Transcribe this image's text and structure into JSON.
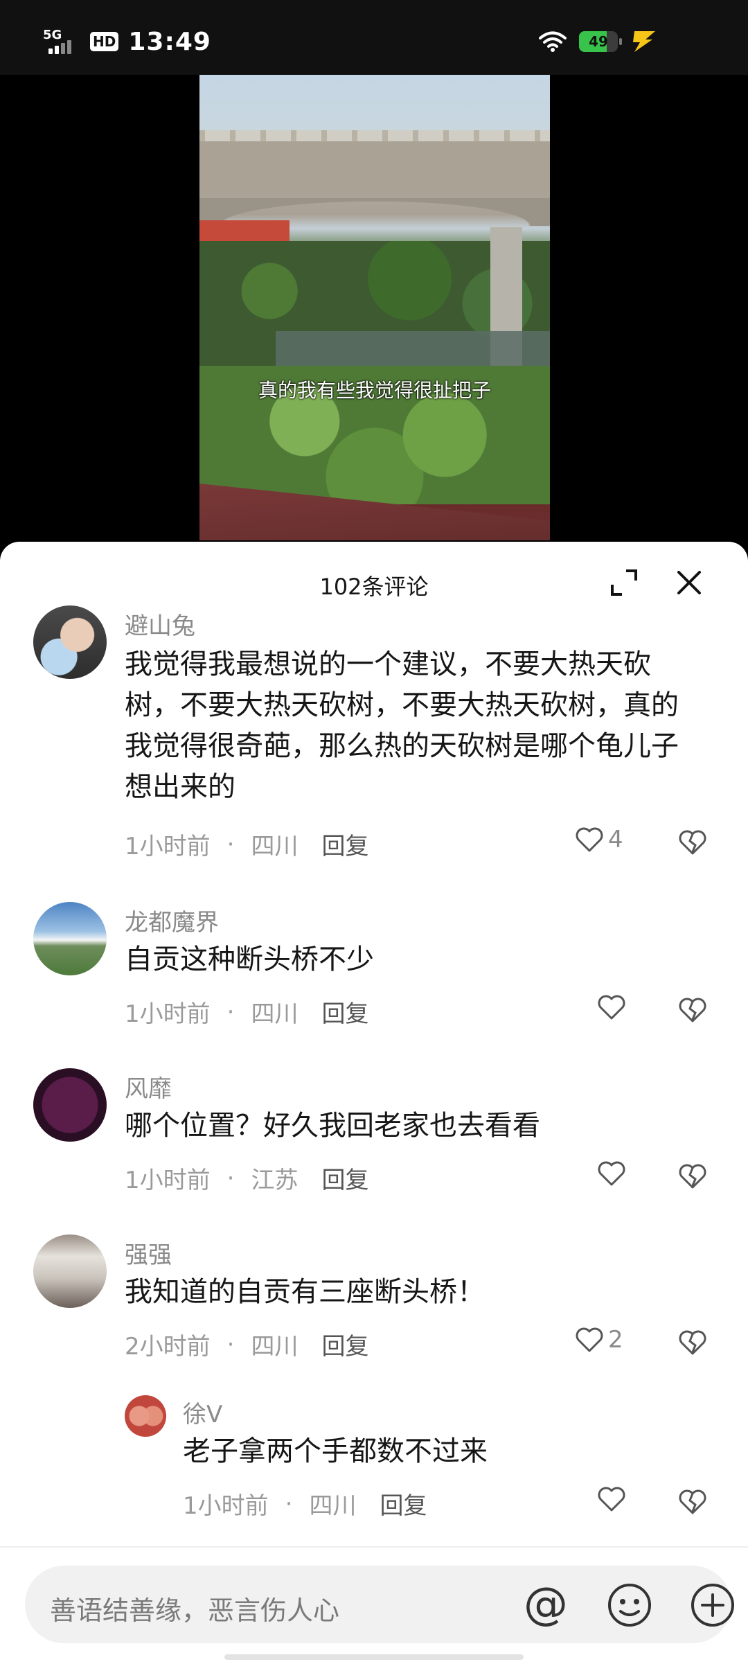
{
  "status_bar": {
    "network": "5G",
    "hd": "HD",
    "time": "13:49",
    "battery": "49",
    "battery_level": 0.49,
    "icons": [
      "signal-icon",
      "wifi-icon",
      "battery-icon",
      "charging-bolt-icon"
    ]
  },
  "video": {
    "subtitle": "真的我有些我觉得很扯把子"
  },
  "comments_panel": {
    "title": "102条评论",
    "expand_icon": "expand-icon",
    "close_icon": "close-icon"
  },
  "comments": [
    {
      "user": "避山兔",
      "text": "我觉得我最想说的一个建议，不要大热天砍树，不要大热天砍树，不要大热天砍树，真的我觉得很奇葩，那么热的天砍树是哪个龟儿子想出来的",
      "time": "1小时前",
      "location": "四川",
      "reply": "回复",
      "likes": "4"
    },
    {
      "user": "龙都魔界",
      "text": "自贡这种断头桥不少",
      "time": "1小时前",
      "location": "四川",
      "reply": "回复",
      "likes": ""
    },
    {
      "user": "风靡",
      "text": "哪个位置？好久我回老家也去看看",
      "time": "1小时前",
      "location": "江苏",
      "reply": "回复",
      "likes": ""
    },
    {
      "user": "强强",
      "text": "我知道的自贡有三座断头桥！",
      "time": "2小时前",
      "location": "四川",
      "reply": "回复",
      "likes": "2"
    },
    {
      "user": "徐V",
      "text": "老子拿两个手都数不过来",
      "time": "1小时前",
      "location": "四川",
      "reply": "回复",
      "likes": ""
    }
  ],
  "input_bar": {
    "placeholder": "善语结善缘，恶言伤人心",
    "at_symbol": "@",
    "icons": [
      "at-icon",
      "emoji-icon",
      "plus-icon"
    ]
  },
  "colors": {
    "accent_battery": "#38c44a",
    "charging": "#f5c518",
    "text_primary": "#161616",
    "text_secondary": "#8a8a8a"
  }
}
